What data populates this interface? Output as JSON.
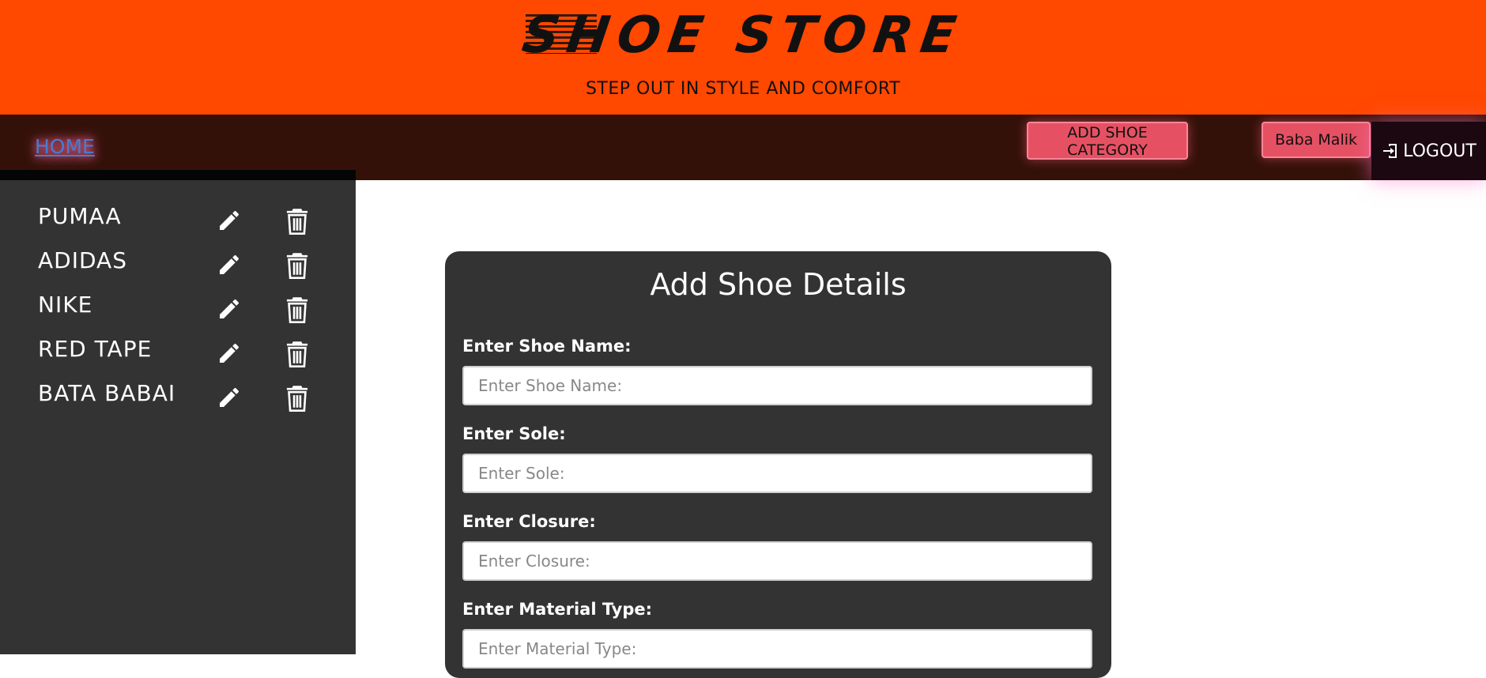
{
  "header": {
    "logo_text": "SHOE STORE",
    "tagline": "STEP OUT IN STYLE AND COMFORT",
    "background": "#ff4800"
  },
  "nav": {
    "home_label": "HOME",
    "add_category_label": "ADD SHOE CATEGORY",
    "user_label": "Baba Malik",
    "logout_label": "LOGOUT",
    "accent": "#e55163"
  },
  "sidebar": {
    "categories": [
      {
        "label": "PUMAA"
      },
      {
        "label": "ADIDAS"
      },
      {
        "label": "NIKE"
      },
      {
        "label": "RED TAPE"
      },
      {
        "label": "BATA BABAI"
      }
    ],
    "icons": {
      "edit": "pencil-icon",
      "delete": "trash-icon"
    }
  },
  "form": {
    "title": "Add Shoe Details",
    "fields": [
      {
        "label": "Enter Shoe Name:",
        "placeholder": "Enter Shoe Name:",
        "value": ""
      },
      {
        "label": "Enter Sole:",
        "placeholder": "Enter Sole:",
        "value": ""
      },
      {
        "label": "Enter Closure:",
        "placeholder": "Enter Closure:",
        "value": ""
      },
      {
        "label": "Enter Material Type:",
        "placeholder": "Enter Material Type:",
        "value": ""
      }
    ]
  }
}
